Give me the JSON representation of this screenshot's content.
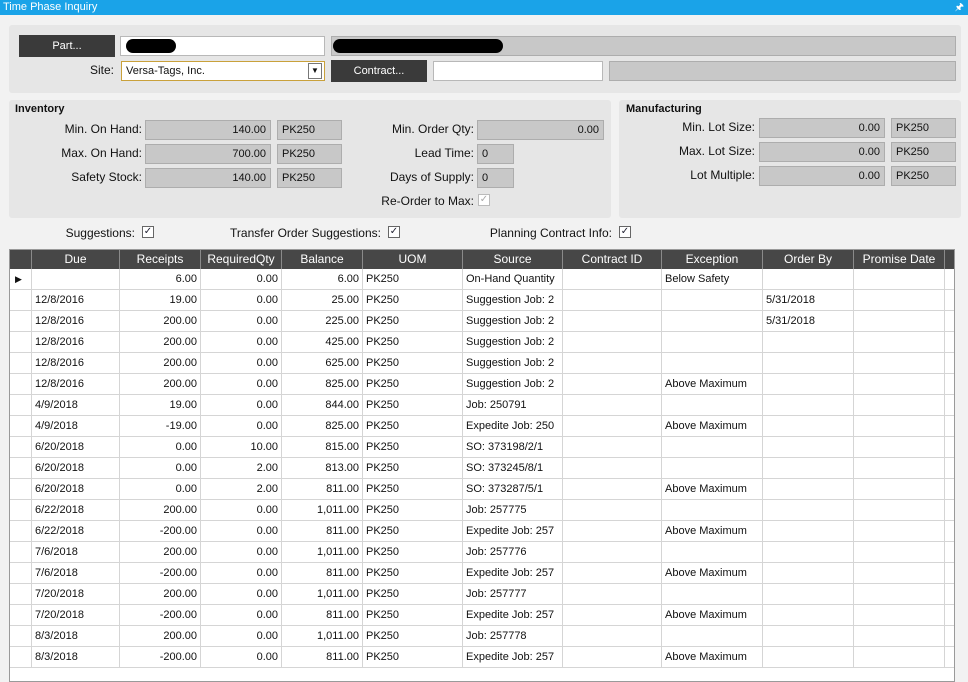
{
  "window": {
    "title": "Time Phase Inquiry",
    "pin_icon": "pin-icon"
  },
  "header": {
    "part_button": "Part...",
    "site_label": "Site:",
    "site_value": "Versa-Tags, Inc.",
    "contract_button": "Contract..."
  },
  "inventory": {
    "title": "Inventory",
    "min_on_hand_label": "Min. On Hand:",
    "min_on_hand": "140.00",
    "min_on_hand_uom": "PK250",
    "max_on_hand_label": "Max. On Hand:",
    "max_on_hand": "700.00",
    "max_on_hand_uom": "PK250",
    "safety_stock_label": "Safety Stock:",
    "safety_stock": "140.00",
    "safety_stock_uom": "PK250",
    "min_order_qty_label": "Min. Order Qty:",
    "min_order_qty": "0.00",
    "lead_time_label": "Lead Time:",
    "lead_time": "0",
    "days_of_supply_label": "Days of Supply:",
    "days_of_supply": "0",
    "reorder_to_max_label": "Re-Order to Max:"
  },
  "manufacturing": {
    "title": "Manufacturing",
    "min_lot_label": "Min. Lot Size:",
    "min_lot": "0.00",
    "min_lot_uom": "PK250",
    "max_lot_label": "Max. Lot Size:",
    "max_lot": "0.00",
    "max_lot_uom": "PK250",
    "lot_multiple_label": "Lot Multiple:",
    "lot_multiple": "0.00",
    "lot_multiple_uom": "PK250"
  },
  "options": {
    "suggestions_label": "Suggestions:",
    "transfer_label": "Transfer Order Suggestions:",
    "planning_label": "Planning Contract Info:"
  },
  "grid": {
    "columns": [
      "Due",
      "Receipts",
      "RequiredQty",
      "Balance",
      "UOM",
      "Source",
      "Contract ID",
      "Exception",
      "Order By",
      "Promise Date"
    ],
    "rows": [
      [
        "",
        "6.00",
        "0.00",
        "6.00",
        "PK250",
        "On-Hand Quantity",
        "",
        "Below Safety",
        "",
        ""
      ],
      [
        "12/8/2016",
        "19.00",
        "0.00",
        "25.00",
        "PK250",
        "Suggestion Job: 2",
        "",
        "",
        "5/31/2018",
        ""
      ],
      [
        "12/8/2016",
        "200.00",
        "0.00",
        "225.00",
        "PK250",
        "Suggestion Job: 2",
        "",
        "",
        "5/31/2018",
        ""
      ],
      [
        "12/8/2016",
        "200.00",
        "0.00",
        "425.00",
        "PK250",
        "Suggestion Job: 2",
        "",
        "",
        "",
        ""
      ],
      [
        "12/8/2016",
        "200.00",
        "0.00",
        "625.00",
        "PK250",
        "Suggestion Job: 2",
        "",
        "",
        "",
        ""
      ],
      [
        "12/8/2016",
        "200.00",
        "0.00",
        "825.00",
        "PK250",
        "Suggestion Job: 2",
        "",
        "Above Maximum",
        "",
        ""
      ],
      [
        "4/9/2018",
        "19.00",
        "0.00",
        "844.00",
        "PK250",
        "Job: 250791",
        "",
        "",
        "",
        ""
      ],
      [
        "4/9/2018",
        "-19.00",
        "0.00",
        "825.00",
        "PK250",
        "Expedite Job: 250",
        "",
        "Above Maximum",
        "",
        ""
      ],
      [
        "6/20/2018",
        "0.00",
        "10.00",
        "815.00",
        "PK250",
        "SO: 373198/2/1",
        "",
        "",
        "",
        ""
      ],
      [
        "6/20/2018",
        "0.00",
        "2.00",
        "813.00",
        "PK250",
        "SO: 373245/8/1",
        "",
        "",
        "",
        ""
      ],
      [
        "6/20/2018",
        "0.00",
        "2.00",
        "811.00",
        "PK250",
        "SO: 373287/5/1",
        "",
        "Above Maximum",
        "",
        ""
      ],
      [
        "6/22/2018",
        "200.00",
        "0.00",
        "1,011.00",
        "PK250",
        "Job: 257775",
        "",
        "",
        "",
        ""
      ],
      [
        "6/22/2018",
        "-200.00",
        "0.00",
        "811.00",
        "PK250",
        "Expedite Job: 257",
        "",
        "Above Maximum",
        "",
        ""
      ],
      [
        "7/6/2018",
        "200.00",
        "0.00",
        "1,011.00",
        "PK250",
        "Job: 257776",
        "",
        "",
        "",
        ""
      ],
      [
        "7/6/2018",
        "-200.00",
        "0.00",
        "811.00",
        "PK250",
        "Expedite Job: 257",
        "",
        "Above Maximum",
        "",
        ""
      ],
      [
        "7/20/2018",
        "200.00",
        "0.00",
        "1,011.00",
        "PK250",
        "Job: 257777",
        "",
        "",
        "",
        ""
      ],
      [
        "7/20/2018",
        "-200.00",
        "0.00",
        "811.00",
        "PK250",
        "Expedite Job: 257",
        "",
        "Above Maximum",
        "",
        ""
      ],
      [
        "8/3/2018",
        "200.00",
        "0.00",
        "1,011.00",
        "PK250",
        "Job: 257778",
        "",
        "",
        "",
        ""
      ],
      [
        "8/3/2018",
        "-200.00",
        "0.00",
        "811.00",
        "PK250",
        "Expedite Job: 257",
        "",
        "Above Maximum",
        "",
        ""
      ]
    ]
  }
}
